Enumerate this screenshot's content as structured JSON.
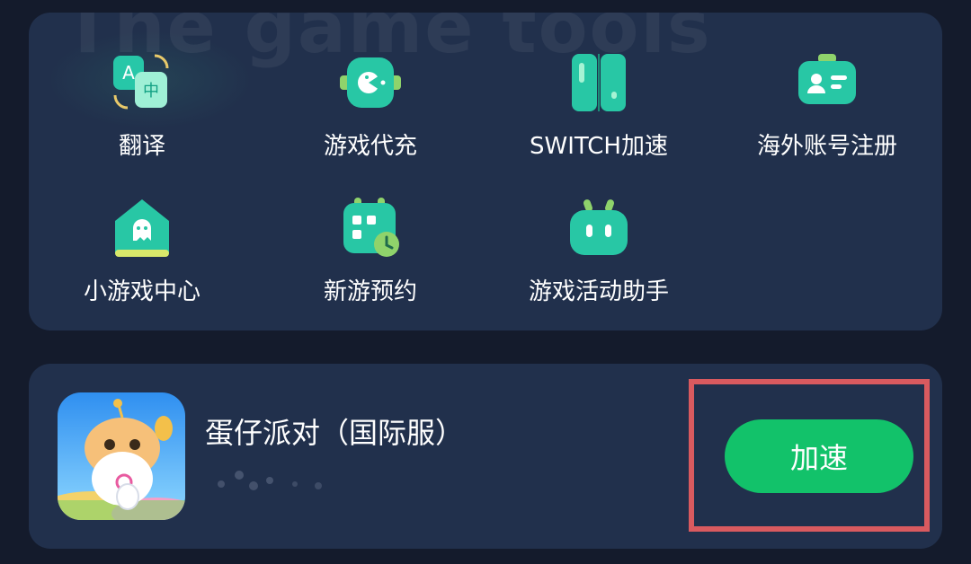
{
  "tools": {
    "watermark": "The game tools",
    "items": [
      {
        "label": "翻译",
        "icon": "translate-icon"
      },
      {
        "label": "游戏代充",
        "icon": "game-topup-icon"
      },
      {
        "label": "SWITCH加速",
        "icon": "switch-icon"
      },
      {
        "label": "海外账号注册",
        "icon": "overseas-account-icon"
      },
      {
        "label": "小游戏中心",
        "icon": "mini-game-center-icon"
      },
      {
        "label": "新游预约",
        "icon": "new-game-reservation-icon"
      },
      {
        "label": "游戏活动助手",
        "icon": "game-event-assistant-icon"
      }
    ]
  },
  "game": {
    "name": "蛋仔派对（国际服）",
    "action_label": "加速"
  },
  "colors": {
    "background": "#141b2c",
    "card": "#21304c",
    "accent_green": "#12c26a",
    "highlight_border": "#d95a5f"
  }
}
